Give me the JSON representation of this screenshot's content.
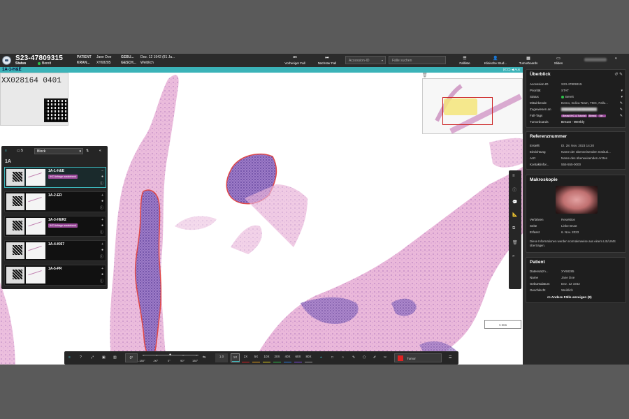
{
  "header": {
    "case_id": "S23-47809315",
    "status_label": "Status",
    "status_value": "Bereit",
    "patient_label": "PATIENT",
    "patient_value": "Jane Doe",
    "kran_label": "KRAN...",
    "kran_value": "XY68285",
    "geb_label": "GEBU...",
    "geb_value": "Dez. 12 1942 (81 Ja...",
    "gesch_label": "GESCH...",
    "gesch_value": "Weiblich",
    "prev_case": "Vorheriger Fall",
    "next_case": "Nächster Fall",
    "accession_placeholder": "Accession-ID",
    "search_placeholder": "Fälle suchen",
    "nav": [
      "Fallliste",
      "Klinische Stud...",
      "Tumorboards",
      "Slides"
    ]
  },
  "slide_tab": {
    "label": "1A-1-H&E",
    "right_text": "(ICC)  ◀ Aus"
  },
  "viewer": {
    "barcode_text": "XX028164 0401",
    "scale_label": "1 mm"
  },
  "tray": {
    "count": "5",
    "select_value": "Block",
    "block_label": "1A",
    "slides": [
      {
        "name": "1A-1-H&E",
        "badge": "IHC Anfrage ausstehend"
      },
      {
        "name": "1A-2-ER",
        "badge": ""
      },
      {
        "name": "1A-3-HER2",
        "badge": "IHC Anfrage ausstehend"
      },
      {
        "name": "1A-4-KI67",
        "badge": ""
      },
      {
        "name": "1A-5-PR",
        "badge": ""
      }
    ]
  },
  "toolbar": {
    "rotation": "0°",
    "rot_ticks": [
      "-180°",
      "-90°",
      "0°",
      "90°",
      "180°"
    ],
    "zoom_current": "1.0",
    "zoom_levels": [
      "1X",
      "2X",
      "5X",
      "10X",
      "20X",
      "40X",
      "60X",
      "80X"
    ],
    "annotation_label": "Tumor",
    "zoom_colors": [
      "#3bb3b8",
      "#d22",
      "#e8a01c",
      "#e6d21c",
      "#2ec24a",
      "#2a7be0",
      "#7b4be0",
      "#999999"
    ]
  },
  "overview": {
    "title": "Überblick",
    "rows": [
      {
        "k": "Accession-ID",
        "v": "S23-47809315"
      },
      {
        "k": "Priorität",
        "v": "STAT"
      },
      {
        "k": "Status",
        "v": "Bereit"
      },
      {
        "k": "Mitwirkende",
        "v": "Demo, Indica Team, TMC, Fallu..."
      },
      {
        "k": "Zugewiesen an",
        "v": ""
      },
      {
        "k": "Fall-Tags",
        "v": ""
      },
      {
        "k": "Tumorboards",
        "v": "Breast - Weekly"
      }
    ],
    "tags": [
      "Breast IHC & Tutorial",
      "Breast",
      "Ne..."
    ]
  },
  "reference": {
    "title": "Referenznummer",
    "rows": [
      {
        "k": "Erstellt",
        "v": "Di. 28. Nov. 2023 14:20"
      },
      {
        "k": "Einrichtung",
        "v": "Name der überweisenden Instituti..."
      },
      {
        "k": "Arzt",
        "v": "Name des überweisenden Arztes"
      },
      {
        "k": "Kontaktinfor...",
        "v": "555-555-0000"
      }
    ]
  },
  "macro": {
    "title": "Makroskopie",
    "rows": [
      {
        "k": "Verfahren",
        "v": "Resektion"
      },
      {
        "k": "Seite",
        "v": "Linke Brust"
      },
      {
        "k": "Erfasst",
        "v": "6. Nov. 2023"
      }
    ],
    "note": "Diese Informationen werden normalerweise aus einem LIS/LIMS übertragen."
  },
  "patient": {
    "title": "Patient",
    "rows": [
      {
        "k": "Datensatzn...",
        "v": "XY68285"
      },
      {
        "k": "Name",
        "v": "Jane Doe"
      },
      {
        "k": "Geburtsdatum",
        "v": "Dez. 12 1942"
      },
      {
        "k": "Geschlecht",
        "v": "Weiblich"
      }
    ],
    "other_cases": "Andere Fälle anzeigen (8)"
  }
}
